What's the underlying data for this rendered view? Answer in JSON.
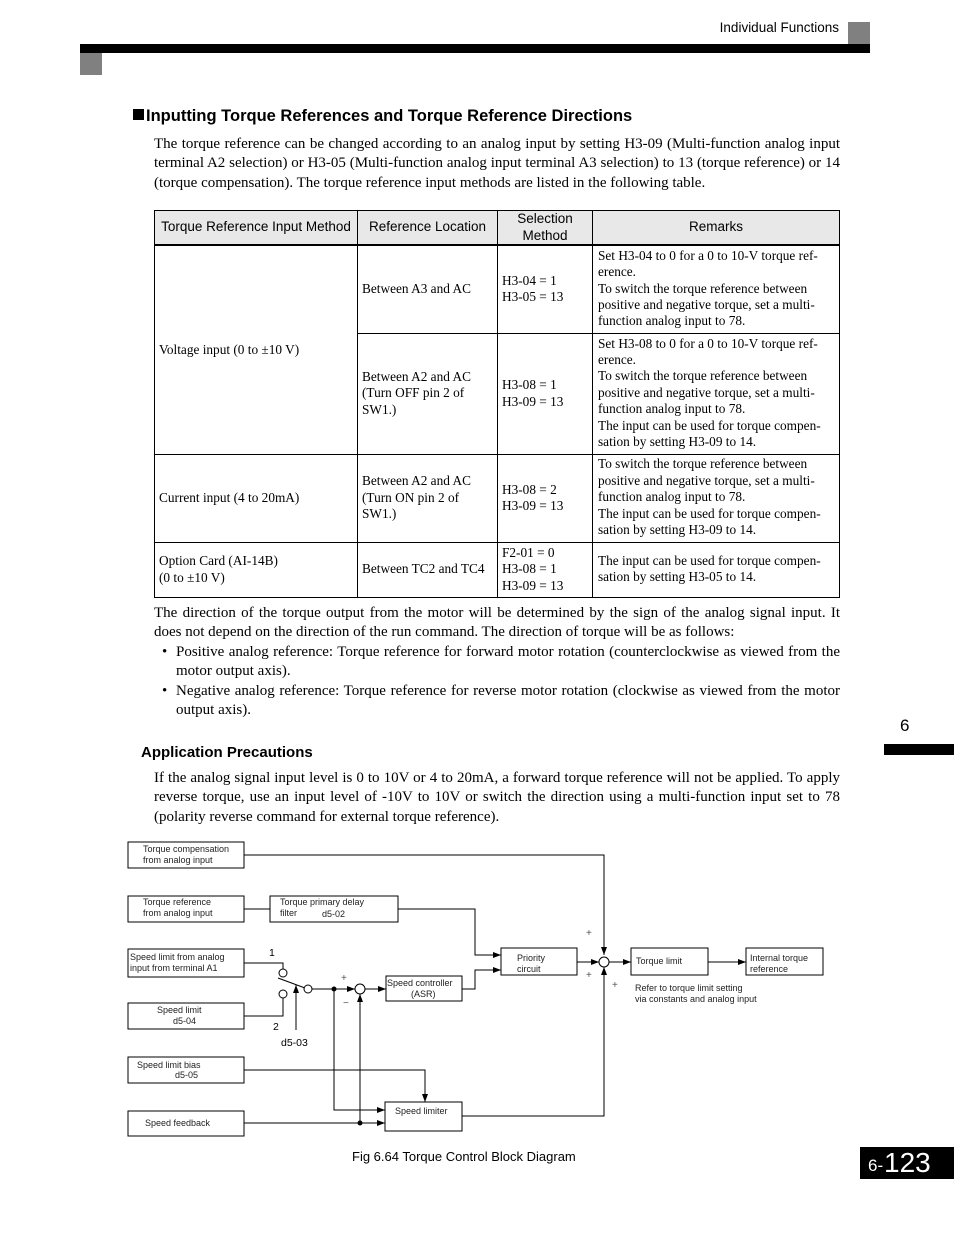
{
  "header": {
    "section_title": "Individual Functions"
  },
  "section": {
    "heading": "Inputting Torque References and Torque Reference Directions",
    "intro": "The torque reference can be changed according to an analog input by setting H3-09 (Multi-function analog input terminal A2 selection) or H3-05 (Multi-function analog input terminal A3 selection) to 13 (torque reference) or 14 (torque compensation). The torque reference input methods are listed in the following table."
  },
  "table": {
    "headers": [
      "Torque Reference Input Method",
      "Reference Location",
      "Selection Method",
      "Remarks"
    ],
    "rows": [
      {
        "method": "Voltage input (0 to ±10 V)",
        "sub": [
          {
            "location": "Between A3 and AC",
            "selection": [
              "H3-04 = 1",
              "H3-05 = 13"
            ],
            "remarks": [
              "Set H3-04 to 0 for a 0 to 10-V torque ref­erence.",
              "To switch the torque reference between positive and negative torque, set a multi-function analog input to 78."
            ]
          },
          {
            "location": "Between A2 and AC (Turn OFF pin 2 of SW1.)",
            "selection": [
              "H3-08 = 1",
              "H3-09 = 13"
            ],
            "remarks": [
              "Set H3-08 to 0 for a 0 to 10-V torque ref­erence.",
              "To switch the torque reference between positive and negative torque, set a multi-function analog input to 78.",
              "The input can be used for torque compen­sation by setting H3-09 to 14."
            ]
          }
        ]
      },
      {
        "method": "Current input (4 to 20mA)",
        "sub": [
          {
            "location": "Between A2 and AC (Turn ON pin 2 of SW1.)",
            "selection": [
              "H3-08 = 2",
              "H3-09 = 13"
            ],
            "remarks": [
              "To switch the torque reference between positive and negative torque, set a multi-function analog input to 78.",
              "The input can be used for torque compen­sation by setting H3-09 to 14."
            ]
          }
        ]
      },
      {
        "method": [
          "Option Card (AI-14B)",
          "(0 to ±10 V)"
        ],
        "sub": [
          {
            "location": "Between TC2 and TC4",
            "selection": [
              "F2-01 = 0",
              "H3-08 = 1",
              "H3-09 = 13"
            ],
            "remarks": [
              "The input can be used for torque compen­sation by setting H3-05 to 14."
            ]
          }
        ]
      }
    ]
  },
  "direction": {
    "text": "The direction of the torque output from the motor will be determined by the sign of the analog signal input. It does not depend on the direction of the run command. The direction of torque will be as follows:",
    "bullets": [
      "Positive analog reference: Torque reference for forward motor rotation (counterclockwise as viewed from the motor output axis).",
      "Negative analog reference: Torque reference for reverse motor rotation (clockwise as viewed from the motor output axis)."
    ]
  },
  "precautions": {
    "heading": "Application Precautions",
    "text": "If the analog signal input level is 0 to 10V or 4 to 20mA, a forward torque reference will not be applied. To apply reverse torque, use an input level of -10V to 10V or switch the direction using a multi-function input set to 78 (polarity reverse command for external torque reference)."
  },
  "diagram": {
    "caption": "Fig 6.64  Torque Control Block Diagram",
    "blocks": {
      "torque_comp": [
        "Torque compensation",
        "from analog input"
      ],
      "torque_ref": [
        "Torque reference",
        "from analog input"
      ],
      "delay_filter": [
        "Torque primary delay",
        "filter",
        "d5-02"
      ],
      "speed_limit_analog": [
        "Speed limit from analog",
        "input from terminal A1"
      ],
      "speed_limit_param": [
        "Speed limit",
        "d5-04"
      ],
      "speed_limit_bias": [
        "Speed limit bias",
        "d5-05"
      ],
      "speed_feedback": [
        "Speed feedback"
      ],
      "speed_controller": [
        "Speed controller",
        "(ASR)"
      ],
      "priority_circuit": [
        "Priority",
        "circuit"
      ],
      "torque_limit": [
        "Torque limit"
      ],
      "internal_torque_ref": [
        "Internal torque",
        "reference"
      ],
      "speed_limiter": [
        "Speed limiter"
      ]
    },
    "labels": {
      "switch_pos1": "1",
      "switch_pos2": "2",
      "switch_param": "d5-03",
      "plus": "+",
      "minus": "−",
      "torque_limit_note": [
        "Refer to torque limit setting",
        "via constants and analog input"
      ]
    }
  },
  "side_marker": {
    "chapter": "6"
  },
  "page_number": {
    "prefix": "6-",
    "number": "123"
  }
}
